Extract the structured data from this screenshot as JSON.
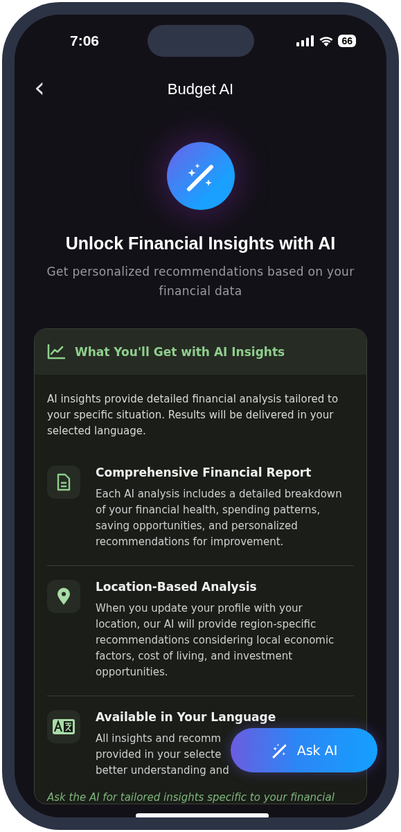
{
  "status_bar": {
    "time": "7:06",
    "battery": "66"
  },
  "nav": {
    "back": "‹",
    "title": "Budget AI"
  },
  "hero": {
    "title": "Unlock Financial Insights with AI",
    "subtitle": "Get personalized recommendations based on your financial data"
  },
  "card": {
    "title": "What You'll Get with AI Insights",
    "intro": "AI insights provide detailed financial analysis tailored to your specific situation. Results will be delivered in your selected language.",
    "features": [
      {
        "kind": "report",
        "title": "Comprehensive Financial Report",
        "lines": [
          "Each AI analysis includes a detailed breakdown",
          "of your financial health, spending patterns,",
          "saving opportunities, and personalized",
          "recommendations for improvement."
        ]
      },
      {
        "kind": "location",
        "title": "Location-Based Analysis",
        "lines": [
          "When you update your profile with your",
          "location, our AI will provide region-specific",
          "recommendations considering local economic",
          "factors, cost of living, and investment",
          "opportunities."
        ]
      },
      {
        "kind": "language",
        "title": "Available in Your Language",
        "lines": [
          "All insights and recomm",
          "provided in your selecte",
          "better understanding and"
        ]
      }
    ],
    "footer": "Ask the AI for tailored insights specific to your financial"
  },
  "fab": {
    "label": "Ask AI"
  }
}
